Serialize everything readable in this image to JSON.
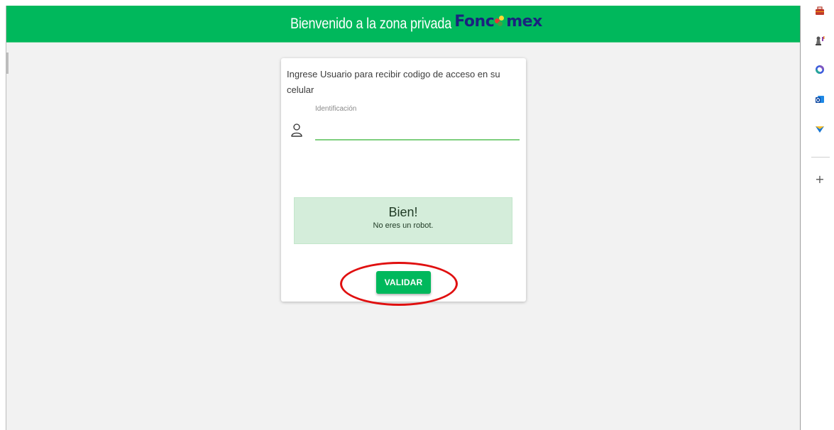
{
  "header": {
    "title": "Bienvenido a la zona privada",
    "brand": {
      "prefix": "Fonc",
      "suffix": "mex",
      "text_color": "#1a237e"
    },
    "background_color": "#00b85c"
  },
  "login_card": {
    "instruction": "Ingrese Usuario para recibir codigo de acceso en su celular",
    "identification_field": {
      "label": "Identificación",
      "value": "",
      "icon": "user-icon"
    },
    "captcha": {
      "title": "Bien!",
      "message": "No eres un robot.",
      "background_color": "#d4edda"
    },
    "validate_button": {
      "label": "VALIDAR",
      "color": "#00b85c",
      "highlighted": true,
      "highlight_color": "#e01010"
    }
  },
  "side_panel": {
    "icons": [
      "briefcase-icon",
      "chess-piece-icon",
      "copilot-icon",
      "outlook-icon",
      "send-icon"
    ],
    "add_label": "+"
  }
}
